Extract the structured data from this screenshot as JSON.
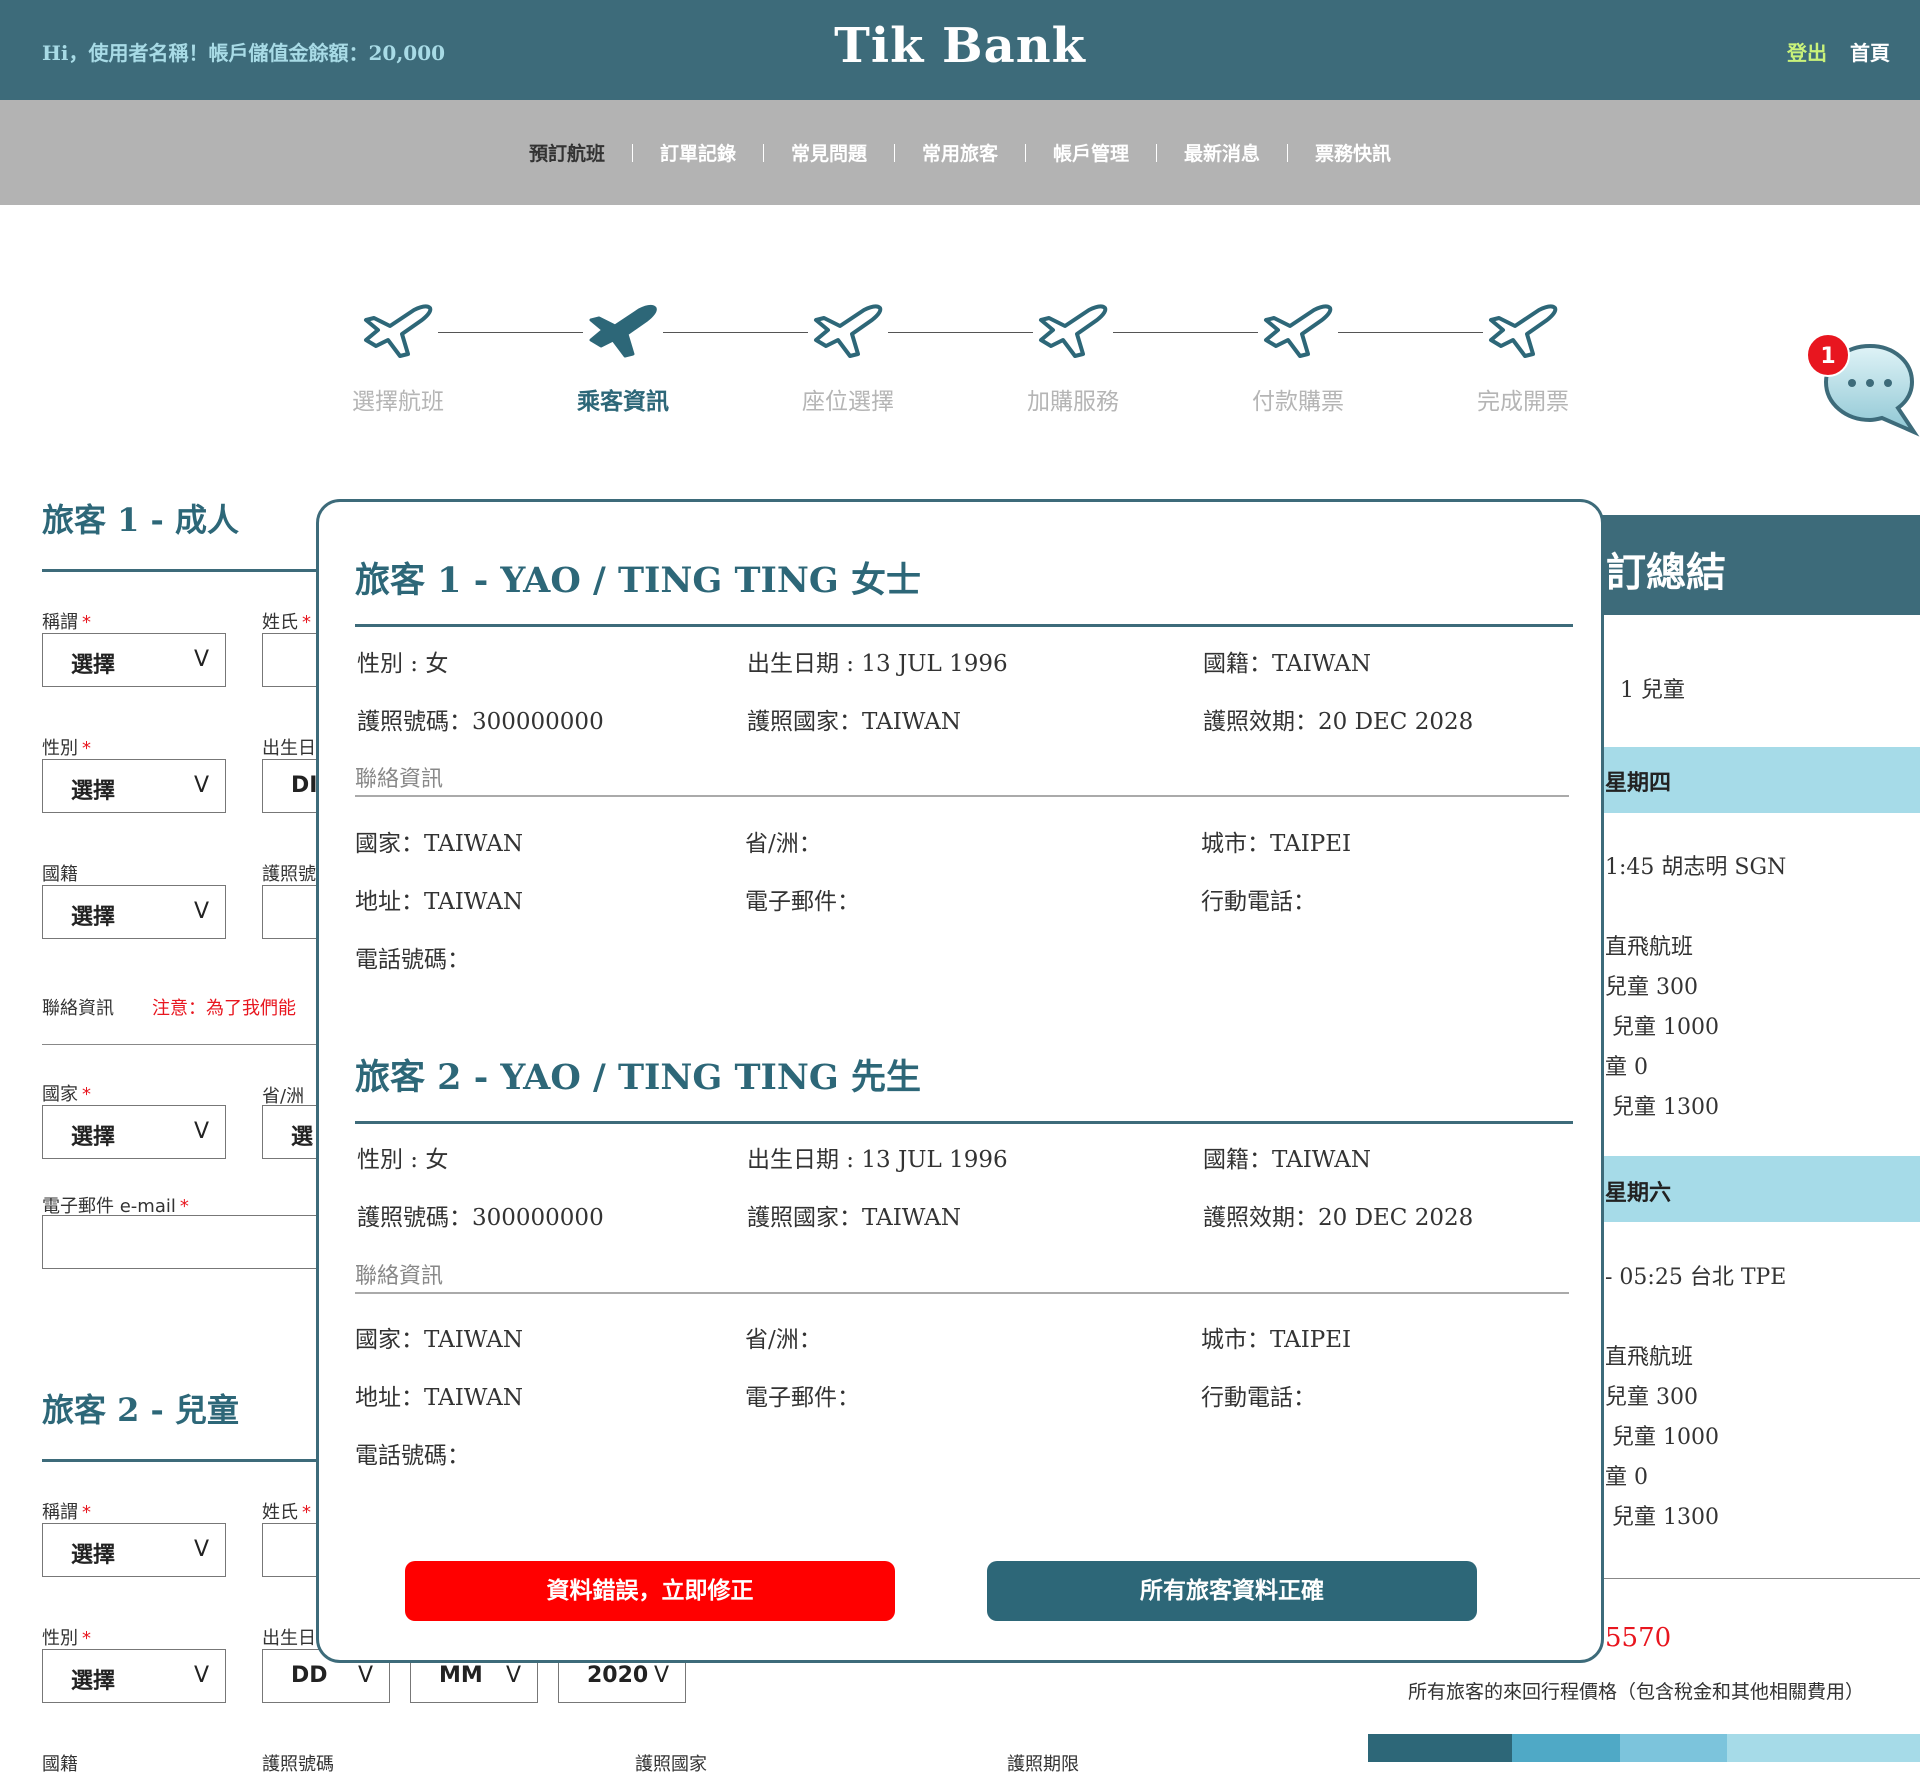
{
  "header": {
    "greeting": "Hi，使用者名稱！帳戶儲值金餘額：20,000",
    "logo": "Tik Bank",
    "logout": "登出",
    "home": "首頁"
  },
  "nav": [
    "預訂航班",
    "訂單記錄",
    "常見問題",
    "常用旅客",
    "帳戶管理",
    "最新消息",
    "票務快訊"
  ],
  "steps": [
    "選擇航班",
    "乘客資訊",
    "座位選擇",
    "加購服務",
    "付款購票",
    "完成開票"
  ],
  "active_step": "乘客資訊",
  "chat": {
    "badge": "1",
    "icon": "chat-bubble-icon"
  },
  "form": {
    "p1_title": "旅客 1 - 成人",
    "p2_title": "旅客 2 - 兒童",
    "title_label": "稱謂",
    "surname_label": "姓氏",
    "gender_label": "性別",
    "birth_label": "出生日",
    "nationality_label": "國籍",
    "passport_label": "護照號",
    "passport_no_label": "護照號碼",
    "passport_country_label": "護照國家",
    "passport_expiry_label": "護照期限",
    "contact_label": "聯絡資訊",
    "contact_note": "注意：為了我們能",
    "country_label": "國家",
    "province_label": "省/洲",
    "email_label": "電子郵件 e-mail",
    "select": "選擇",
    "select_partial": "選",
    "chevron": "V",
    "dd": "DD",
    "dd_partial": "DI",
    "mm": "MM",
    "year": "2020"
  },
  "sidebar": {
    "title": "訂總結",
    "passengers": "1 兒童",
    "day1": "星期四",
    "route1": "1:45 胡志明 SGN",
    "flight_type": "直飛航班",
    "p1_l1": "兒童 300",
    "p1_l2": "兒童 1000",
    "p1_l3": "童 0",
    "p1_l4": "兒童 1300",
    "day2": "星期六",
    "route2": "- 05:25 台北 TPE",
    "total": "5570",
    "total_desc": "所有旅客的來回行程價格（包含稅金和其他相關費用）"
  },
  "modal": {
    "passengers": [
      {
        "title": "旅客 1 - YAO / TING TING 女士",
        "gender": "性別 : 女",
        "birth": "出生日期 : 13 JUL 1996",
        "nationality": "國籍：TAIWAN",
        "passport_no": "護照號碼：300000000",
        "passport_country": "護照國家：TAIWAN",
        "passport_expiry": "護照效期：20 DEC 2028",
        "contact_heading": "聯絡資訊",
        "country": "國家：TAIWAN",
        "province": "省/洲：",
        "city": "城市：TAIPEI",
        "address": "地址：TAIWAN",
        "email": "電子郵件：",
        "mobile": "行動電話：",
        "phone": "電話號碼："
      },
      {
        "title": "旅客 2 - YAO / TING TING 先生",
        "gender": "性別 : 女",
        "birth": "出生日期 : 13 JUL 1996",
        "nationality": "國籍：TAIWAN",
        "passport_no": "護照號碼：300000000",
        "passport_country": "護照國家：TAIWAN",
        "passport_expiry": "護照效期：20 DEC 2028",
        "contact_heading": "聯絡資訊",
        "country": "國家：TAIWAN",
        "province": "省/洲：",
        "city": "城市：TAIPEI",
        "address": "地址：TAIWAN",
        "email": "電子郵件：",
        "mobile": "行動電話：",
        "phone": "電話號碼："
      }
    ],
    "btn_fix": "資料錯誤，立即修正",
    "btn_ok": "所有旅客資料正確"
  },
  "colors": {
    "brand": "#3d6b7a",
    "accent": "#2d6778",
    "light_band": "#a6dbe8",
    "alert": "#ff0000",
    "logout": "#c9f27a"
  }
}
